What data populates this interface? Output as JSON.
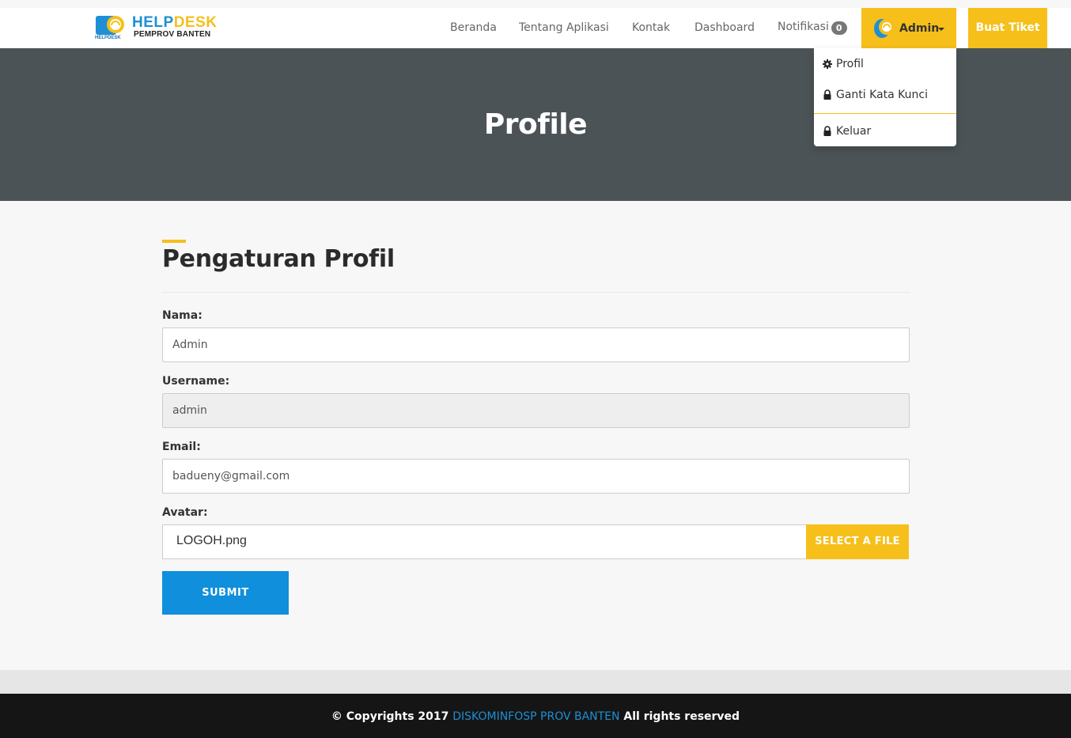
{
  "brand": {
    "name_a": "HELP",
    "name_b": "DESK",
    "subtitle": "PEMPROV BANTEN",
    "tiny": "HELPDESK"
  },
  "nav": {
    "beranda": "Beranda",
    "tentang": "Tentang Aplikasi",
    "kontak": "Kontak",
    "dashboard": "Dashboard",
    "notifikasi": "Notifikasi",
    "notif_count": "0",
    "admin": "Admin",
    "buat_tiket": "Buat Tiket"
  },
  "dropdown": {
    "profil": "Profil",
    "ganti": "Ganti Kata Kunci",
    "keluar": "Keluar"
  },
  "hero": {
    "title": "Profile"
  },
  "form": {
    "title": "Pengaturan Profil",
    "nama_label": "Nama:",
    "nama_value": "Admin",
    "username_label": "Username:",
    "username_value": "admin",
    "email_label": "Email:",
    "email_value": "badueny@gmail.com",
    "avatar_label": "Avatar:",
    "avatar_file": "LOGOH.png",
    "select_file": "SELECT A FILE",
    "submit": "SUBMIT"
  },
  "footer": {
    "prefix": "© Copyrights 2017",
    "org": "DISKOMINFOSP PROV BANTEN",
    "suffix": "All rights reserved"
  },
  "colors": {
    "accent": "#f6bf1a",
    "primary": "#0f8fdc",
    "hero": "#4b5356",
    "footer": "#151515"
  }
}
